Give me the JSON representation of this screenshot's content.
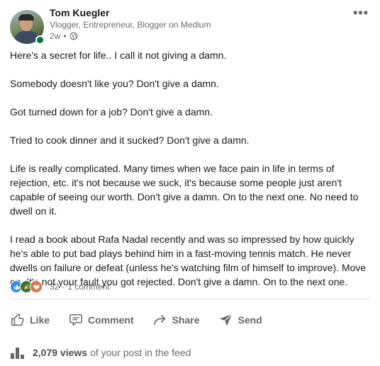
{
  "author": {
    "name": "Tom Kuegler",
    "headline": "Vlogger, Entrepreneur, Blogger on Medium",
    "time": "2w",
    "separator": "•"
  },
  "post": {
    "paragraphs": [
      "Here's a secret for life.. I call it not giving a damn.",
      "Somebody doesn't like you? Don't give a damn.",
      "Got turned down for a job? Don't give a damn.",
      "Tried to cook dinner and it sucked? Don't give a damn.",
      "Life is really complicated. Many times when we face pain in life in terms of rejection, etc. it's not because we suck, it's because some people just aren't capable of seeing our worth. Don't give a damn. On to the next one. No need to dwell on it.",
      "I read a book about Rafa Nadal recently and was so impressed by how quickly he's able to put bad plays behind him in a fast-moving tennis match. He never dwells on failure or defeat (unless he's watching film of himself to improve). Move on. It's not your fault you got rejected. Don't give a damn. On to the next one."
    ]
  },
  "social": {
    "reaction_count": "32",
    "separator": "·",
    "comments": "1 comment",
    "reactions": [
      "like-icon",
      "celebrate-icon",
      "love-icon"
    ]
  },
  "actions": {
    "like": "Like",
    "comment": "Comment",
    "share": "Share",
    "send": "Send"
  },
  "views": {
    "count": "2,079 views",
    "suffix": "of your post in the feed"
  },
  "colors": {
    "online": "#057642",
    "like": "#378fe9",
    "celebrate": "#44712e",
    "love": "#df704d"
  }
}
